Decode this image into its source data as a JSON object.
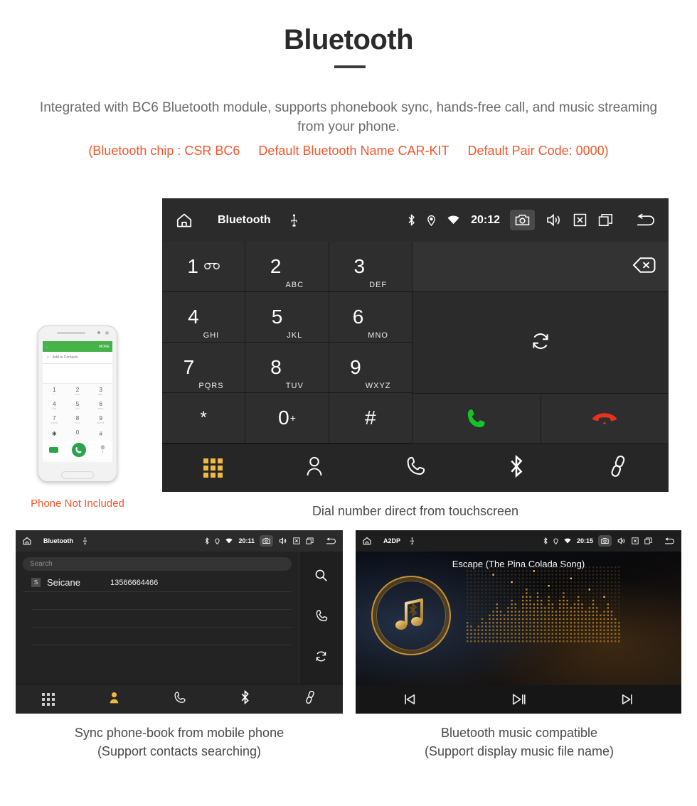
{
  "header": {
    "title": "Bluetooth",
    "intro": "Integrated with BC6 Bluetooth module, supports phonebook sync, hands-free call, and music streaming from your phone.",
    "spec_chip": "(Bluetooth chip : CSR BC6",
    "spec_name": "Default Bluetooth Name CAR-KIT",
    "spec_pair": "Default Pair Code: 0000)",
    "accent_color": "#f4562a",
    "title_color": "#2b2b2b",
    "intro_color": "#6b6b6b"
  },
  "main_screen": {
    "statusbar": {
      "title": "Bluetooth",
      "time": "20:12",
      "icons": [
        "home-icon",
        "usb-icon",
        "bluetooth-icon",
        "location-icon",
        "wifi-icon",
        "camera-icon",
        "volume-icon",
        "close-icon",
        "recents-icon",
        "back-icon"
      ]
    },
    "keys": [
      {
        "num": "1",
        "sub": "",
        "voicemail": true
      },
      {
        "num": "2",
        "sub": "ABC"
      },
      {
        "num": "3",
        "sub": "DEF"
      },
      {
        "num": "4",
        "sub": "GHI"
      },
      {
        "num": "5",
        "sub": "JKL"
      },
      {
        "num": "6",
        "sub": "MNO"
      },
      {
        "num": "7",
        "sub": "PQRS"
      },
      {
        "num": "8",
        "sub": "TUV"
      },
      {
        "num": "9",
        "sub": "WXYZ"
      },
      {
        "num": "*",
        "sub": ""
      },
      {
        "num": "0",
        "sup": "+",
        "sub": ""
      },
      {
        "num": "#",
        "sub": ""
      }
    ],
    "input_value": "",
    "actions": {
      "backspace": "backspace-icon",
      "sync": "sync-icon",
      "call": "call-icon",
      "hangup": "hangup-icon",
      "call_color": "#16c326",
      "hangup_color": "#e8321b"
    },
    "tabs": [
      {
        "name": "dialpad",
        "icon": "dialpad-icon",
        "active": true
      },
      {
        "name": "contacts",
        "icon": "contacts-icon",
        "active": false
      },
      {
        "name": "call-log",
        "icon": "phone-icon",
        "active": false
      },
      {
        "name": "bluetooth",
        "icon": "bluetooth-icon",
        "active": false
      },
      {
        "name": "pair",
        "icon": "link-icon",
        "active": false
      }
    ],
    "active_color": "#f0b942",
    "caption": "Dial number direct from touchscreen"
  },
  "phone_mock": {
    "bar_back": "back-arrow-icon",
    "bar_more": "MORE",
    "add_contacts": "Add to Contacts",
    "keys": [
      {
        "num": "1",
        "sub": "∞"
      },
      {
        "num": "2",
        "sub": "ABC"
      },
      {
        "num": "3",
        "sub": "DEF"
      },
      {
        "num": "4",
        "sub": "GHI"
      },
      {
        "num": "5",
        "sub": "JKL"
      },
      {
        "num": "6",
        "sub": "MNO"
      },
      {
        "num": "7",
        "sub": "PQRS"
      },
      {
        "num": "8",
        "sub": "TUV"
      },
      {
        "num": "9",
        "sub": "WXYZ"
      },
      {
        "num": "✱",
        "sub": ""
      },
      {
        "num": "0",
        "sub": "+"
      },
      {
        "num": "#",
        "sub": ""
      }
    ],
    "note": "Phone Not Included",
    "note_color": "#f4562a",
    "accent_color": "#45b24a"
  },
  "contacts_screen": {
    "statusbar": {
      "title": "Bluetooth",
      "time": "20:11"
    },
    "search_placeholder": "Search",
    "contact": {
      "initial": "S",
      "name": "Seicane",
      "number": "13566664466"
    },
    "side_icons": [
      "search-icon",
      "phone-icon",
      "sync-icon"
    ],
    "tabs": [
      {
        "name": "dialpad",
        "icon": "dialpad-icon",
        "active": false
      },
      {
        "name": "contacts",
        "icon": "contacts-icon",
        "active": true
      },
      {
        "name": "call-log",
        "icon": "phone-icon",
        "active": false
      },
      {
        "name": "bluetooth",
        "icon": "bluetooth-icon",
        "active": false
      },
      {
        "name": "pair",
        "icon": "link-icon",
        "active": false
      }
    ],
    "caption_line1": "Sync phone-book from mobile phone",
    "caption_line2": "(Support contacts searching)"
  },
  "music_screen": {
    "statusbar": {
      "title": "A2DP",
      "time": "20:15"
    },
    "track_name": "Escape (The Pina Colada Song)",
    "controls": [
      {
        "name": "previous",
        "icon": "previous-track-icon"
      },
      {
        "name": "play-pause",
        "icon": "play-pause-icon"
      },
      {
        "name": "next",
        "icon": "next-track-icon"
      }
    ],
    "album_icon": "bluetooth-music-note-icon",
    "gold_color": "#c79236",
    "caption_line1": "Bluetooth music compatible",
    "caption_line2": "(Support display music file name)"
  }
}
